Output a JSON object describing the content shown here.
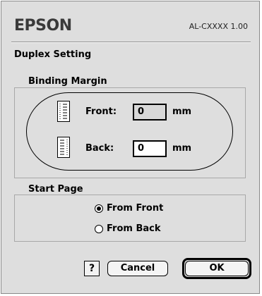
{
  "header": {
    "brand": "EPSON",
    "model": "AL-CXXXX 1.00"
  },
  "dialog": {
    "title": "Duplex Setting"
  },
  "binding_margin": {
    "legend": "Binding Margin",
    "front": {
      "label": "Front:",
      "value": "0",
      "unit": "mm",
      "enabled": false
    },
    "back": {
      "label": "Back:",
      "value": "0",
      "unit": "mm",
      "enabled": true
    }
  },
  "start_page": {
    "legend": "Start Page",
    "options": [
      {
        "label": "From Front",
        "selected": true
      },
      {
        "label": "From Back",
        "selected": false
      }
    ]
  },
  "buttons": {
    "help": "?",
    "cancel": "Cancel",
    "ok": "OK"
  }
}
